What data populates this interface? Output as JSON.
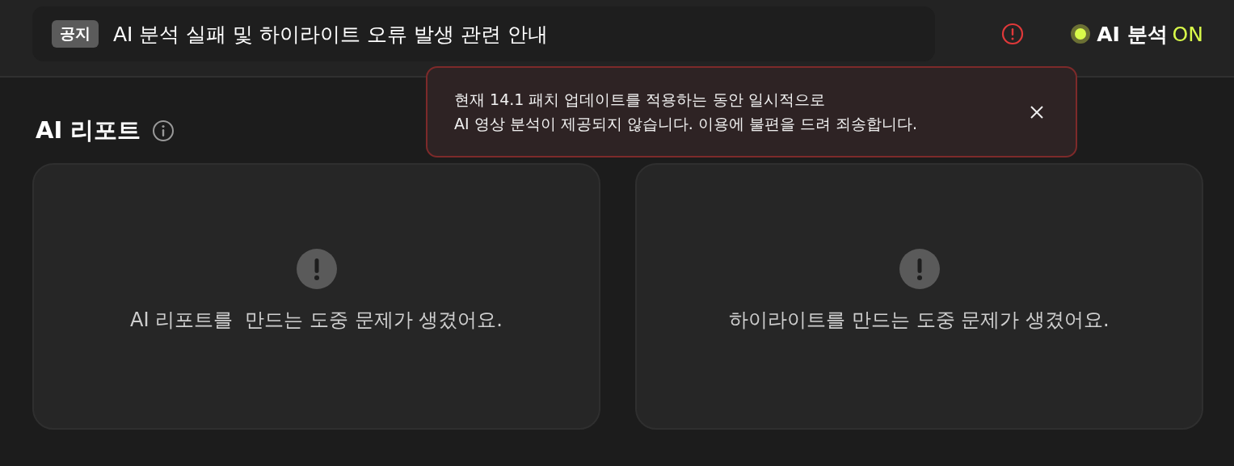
{
  "header": {
    "notice": {
      "badge": "공지",
      "title": "AI 분석 실패 및 하이라이트 오류 발생 관련 안내"
    },
    "ai_status": {
      "label": "AI 분석",
      "value": "ON",
      "on": true
    }
  },
  "tooltip": {
    "lines": [
      "현재 14.1 패치 업데이트를 적용하는 동안 일시적으로",
      "AI 영상 분석이 제공되지 않습니다. 이용에 불편을 드려 죄송합니다."
    ]
  },
  "section": {
    "title": "AI 리포트"
  },
  "cards": [
    {
      "message": "AI 리포트를  만드는 도중 문제가 생겼어요."
    },
    {
      "message": "하이라이트를 만드는 도중 문제가 생겼어요."
    }
  ]
}
